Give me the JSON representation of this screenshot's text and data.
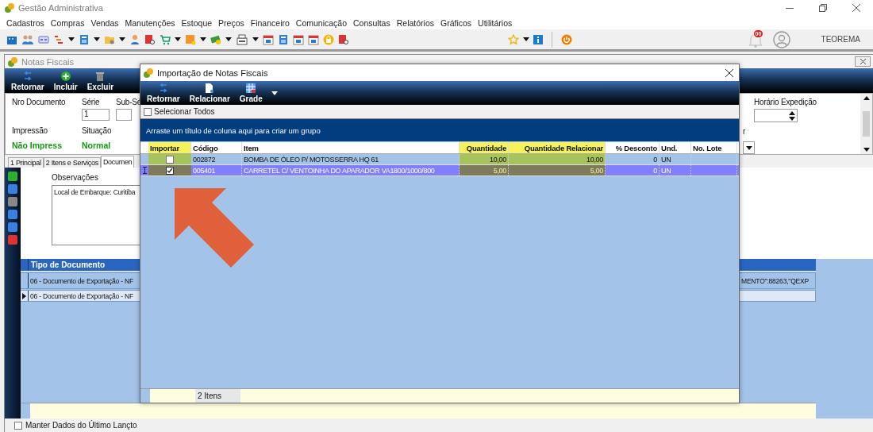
{
  "app": {
    "title": "Gestão Administrativa"
  },
  "menu": [
    "Cadastros",
    "Compras",
    "Vendas",
    "Manutenções",
    "Estoque",
    "Preços",
    "Financeiro",
    "Comunicação",
    "Consultas",
    "Relatórios",
    "Gráficos",
    "Utilitários"
  ],
  "toolbar": {
    "notifications": "00",
    "user": "TEOREMA"
  },
  "child_window": {
    "title": "Notas Fiscais",
    "toolbar": [
      "Retornar",
      "Incluir",
      "Excluir"
    ],
    "form": {
      "nro_label": "Nro Documento",
      "serie_label": "Série",
      "serie_value": "1",
      "subserie_label": "Sub-Sé",
      "impressao_label": "Impressão",
      "impressao_value": "Não Impress",
      "situacao_label": "Situação",
      "situacao_value": "Normal",
      "horario_label": "Horário Expedição",
      "label_cut": "r"
    },
    "tabs": [
      {
        "label": "1 Principal",
        "selected": false
      },
      {
        "label": "2 Itens e Serviços",
        "selected": false
      },
      {
        "label": "Documen",
        "selected": true
      }
    ],
    "observacoes": {
      "label": "Observações",
      "value": "Local de Embarque: Curitiba"
    },
    "grid": {
      "columns": [
        "Tipo de Documento"
      ],
      "rows": [
        {
          "column_1": "06 - Documento de Exportação - NF",
          "column_2": "MENTO\":88263,\"QEXP",
          "selected": false
        },
        {
          "column_1": "06 - Documento de Exportação - NF",
          "selected": true
        }
      ]
    },
    "keep_last": {
      "label": "Manter Dados do Último Lançto",
      "checked": false
    }
  },
  "dialog": {
    "title": "Importação de Notas Fiscais",
    "toolbar": [
      "Retornar",
      "Relacionar",
      "Grade"
    ],
    "select_all": {
      "label": "Selecionar Todos",
      "checked": false
    },
    "group_hint": "Arraste um título de coluna aqui para criar um grupo",
    "columns": [
      {
        "label": "Importar",
        "highlighted": true
      },
      {
        "label": "Código",
        "highlighted": false
      },
      {
        "label": "Item",
        "highlighted": false
      },
      {
        "label": "Quantidade",
        "highlighted": true
      },
      {
        "label": "Quantidade Relacionar",
        "highlighted": true
      },
      {
        "label": "% Desconto",
        "highlighted": false
      },
      {
        "label": "Und.",
        "highlighted": false
      },
      {
        "label": "No. Lote",
        "highlighted": false
      }
    ],
    "rows": [
      {
        "importar": false,
        "codigo": "002872",
        "item": "BOMBA DE ÓLEO P/ MOTOSSERRA HQ 61",
        "quantidade": "10,00",
        "quantidade_relacionar": "10,00",
        "desconto": "0",
        "und": "UN",
        "selected": false
      },
      {
        "importar": true,
        "codigo": "005401",
        "item": "CARRETEL C/ VENTOINHA DO APARADOR VA1800/1000/800",
        "quantidade": "5,00",
        "quantidade_relacionar": "5,00",
        "desconto": "0",
        "und": "UN",
        "selected": true
      }
    ],
    "footer": "2 Itens"
  }
}
